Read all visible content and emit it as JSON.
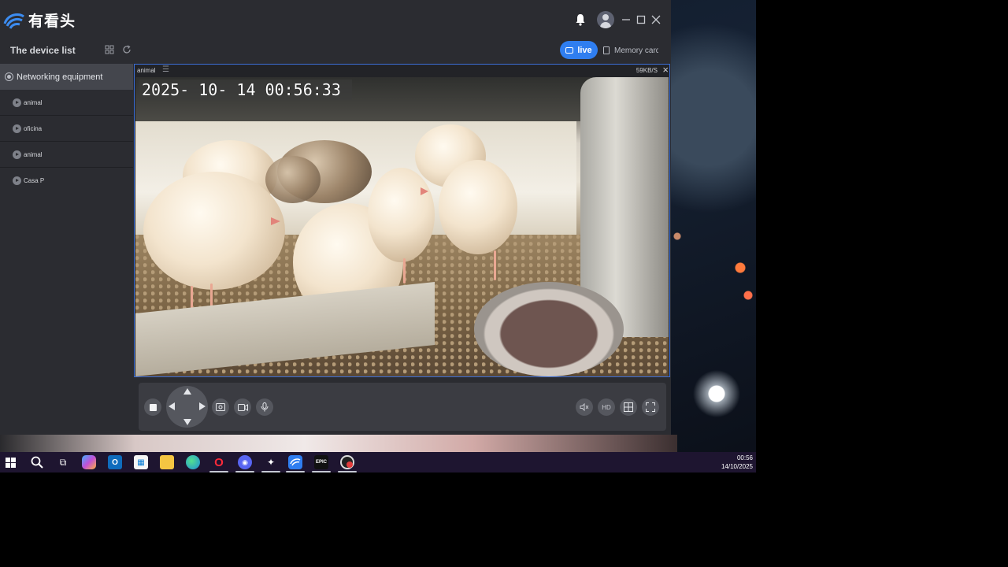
{
  "app": {
    "logo_text": "有看头",
    "brand_color": "#2f7ef0"
  },
  "sidebar": {
    "title": "The device list",
    "group": {
      "label": "Networking equipment"
    },
    "devices": [
      {
        "label": "animal"
      },
      {
        "label": "oficina"
      },
      {
        "label": "animal"
      },
      {
        "label": "Casa P"
      }
    ]
  },
  "toolbar": {
    "live_label": "live",
    "memory_label": "Memory card"
  },
  "player": {
    "channel_name": "animal",
    "bitrate": "59KB/S",
    "osd_timestamp": "2025- 10- 14   00:56:33",
    "hd_label": "HD"
  },
  "taskbar": {
    "time": "00:56",
    "date": "14/10/2025",
    "icons": [
      "windows-start",
      "search",
      "task-view",
      "copilot",
      "outlook",
      "store",
      "file-explorer",
      "edge",
      "opera",
      "discord",
      "steam",
      "app-camera",
      "epic-games",
      "chrome-like"
    ]
  }
}
